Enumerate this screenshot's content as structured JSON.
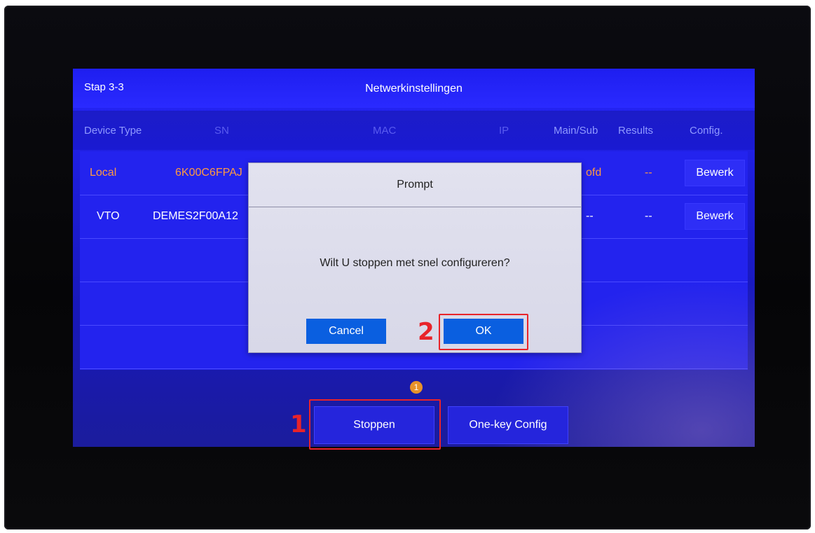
{
  "screen": {
    "step": "Stap 3-3",
    "title": "Netwerkinstellingen"
  },
  "table": {
    "headers": [
      "Device Type",
      "SN",
      "MAC",
      "IP",
      "Main/Sub",
      "Results",
      "Config."
    ],
    "rows": [
      {
        "device_type": "Local",
        "sn": "6K00C6FPAJ",
        "main_sub": "ofd",
        "results": "--",
        "config": "Bewerk"
      },
      {
        "device_type": "VTO",
        "sn": "DEMES2F00A12",
        "main_sub": "--",
        "results": "--",
        "config": "Bewerk"
      }
    ]
  },
  "dialog": {
    "title": "Prompt",
    "message": "Wilt U stoppen met snel configureren?",
    "cancel_label": "Cancel",
    "ok_label": "OK"
  },
  "bottom": {
    "badge": "1",
    "stop_label": "Stoppen",
    "onekey_label": "One-key Config"
  },
  "annotations": {
    "step1": "1",
    "step2": "2"
  },
  "colors": {
    "screen_blue": "#2323ee",
    "local_text": "#ff9a40",
    "button_blue": "#0a5fe0",
    "highlight_red": "#e8232a"
  }
}
